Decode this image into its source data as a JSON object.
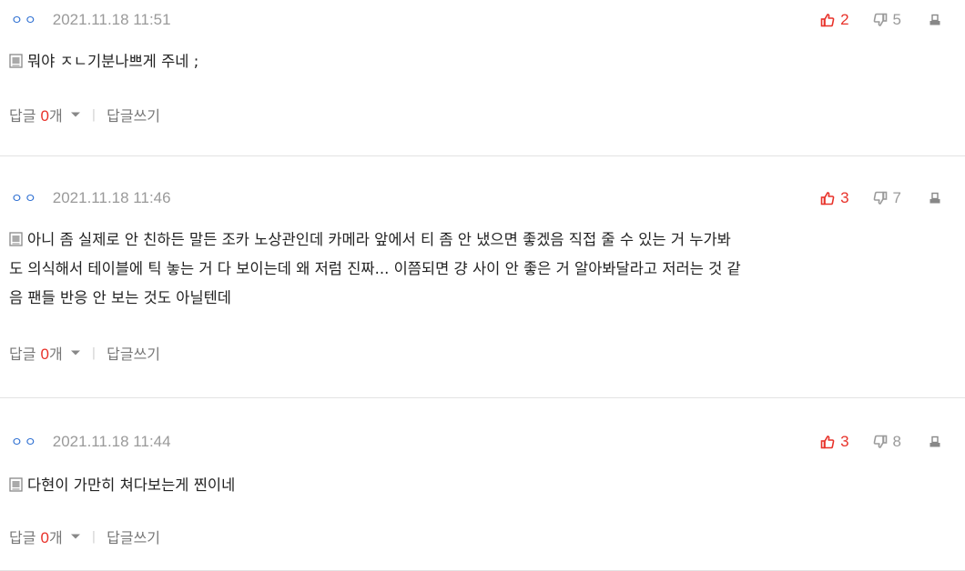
{
  "comments": [
    {
      "nick": "ㅇㅇ",
      "date": "2021.11.18 11:51",
      "up": "2",
      "down": "5",
      "text": "뭐야 ㅈㄴ기분나쁘게 주네 ;",
      "reply_label": "답글",
      "reply_count": "0",
      "reply_unit": "개",
      "write_label": "답글쓰기"
    },
    {
      "nick": "ㅇㅇ",
      "date": "2021.11.18 11:46",
      "up": "3",
      "down": "7",
      "text_lines": [
        "아니 좀 실제로 안 친하든 말든 조카 노상관인데 카메라 앞에서 티 좀 안 냈으면 좋겠음 직접 줄 수 있는 거 누가봐",
        "도 의식해서 테이블에 틱 놓는 거 다 보이는데 왜 저럼 진짜... 이쯤되면 걍 사이 안 좋은 거 알아봐달라고 저러는 것 같",
        "음 팬들 반응 안 보는 것도 아닐텐데"
      ],
      "reply_label": "답글",
      "reply_count": "0",
      "reply_unit": "개",
      "write_label": "답글쓰기"
    },
    {
      "nick": "ㅇㅇ",
      "date": "2021.11.18 11:44",
      "up": "3",
      "down": "8",
      "text": "다현이 가만히 쳐다보는게 찐이네",
      "reply_label": "답글",
      "reply_count": "0",
      "reply_unit": "개",
      "write_label": "답글쓰기"
    }
  ],
  "icons": {
    "thumbs_up": "thumbs-up-icon",
    "thumbs_down": "thumbs-down-icon",
    "print": "print-icon",
    "memo": "memo-icon",
    "caret": "caret-down-icon"
  },
  "colors": {
    "accent_red": "#e8322a",
    "nick_blue": "#2d6fd2",
    "muted_gray": "#9a9a9a",
    "divider": "#e3e3e3"
  }
}
